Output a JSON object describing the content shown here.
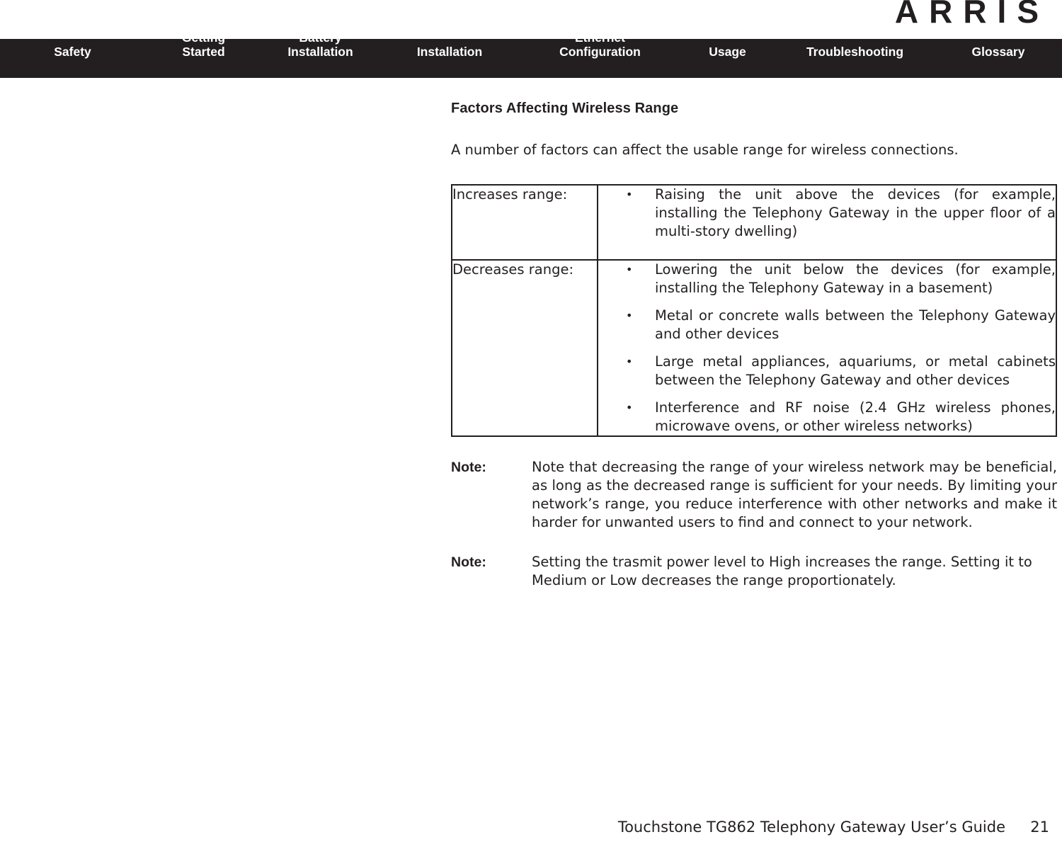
{
  "brand": {
    "logo_text": "ARRIS"
  },
  "nav": {
    "items": [
      {
        "label": "Safety"
      },
      {
        "label": "Getting\nStarted"
      },
      {
        "label": "Battery\nInstallation"
      },
      {
        "label": "Installation"
      },
      {
        "label": "Ethernet\nConfiguration"
      },
      {
        "label": "Usage"
      },
      {
        "label": "Troubleshooting"
      },
      {
        "label": "Glossary"
      }
    ]
  },
  "page": {
    "section_title": "Factors Affecting Wireless Range",
    "intro": "A number of factors can affect the usable range for wireless connections."
  },
  "factors_table": {
    "rows": [
      {
        "label": "Increases range:",
        "items": [
          "Raising the unit above the devices (for example, installing the Telephony Gateway in the upper floor of a multi-story dwelling)"
        ]
      },
      {
        "label": "Decreases range:",
        "items": [
          "Lowering the unit below the devices (for example, installing the Telephony Gateway in a basement)",
          "Metal or concrete walls between the Telephony Gateway and other devices",
          "Large metal appliances, aquariums, or metal cabinets between the Telephony Gateway and other devices",
          "Interference and RF noise (2.4 GHz wireless phones, microwave ovens, or other wireless networks)"
        ]
      }
    ]
  },
  "notes": [
    {
      "label": "Note:",
      "text": "Note that decreasing the range of your wireless network may be beneficial, as long as the decreased range is sufficient for your needs. By limiting your network’s range, you reduce interference with other networks and make it harder for unwanted users to find and connect to your network."
    },
    {
      "label": "Note:",
      "text": "Setting the trasmit power level to High increases the range.  Setting it to Medium or Low decreases the range proportionately."
    }
  ],
  "footer": {
    "title": "Touchstone TG862 Telephony Gateway User’s Guide",
    "page_number": "21"
  },
  "colors": {
    "nav_background": "#231f20",
    "text": "#231f20",
    "page_background": "#ffffff"
  }
}
